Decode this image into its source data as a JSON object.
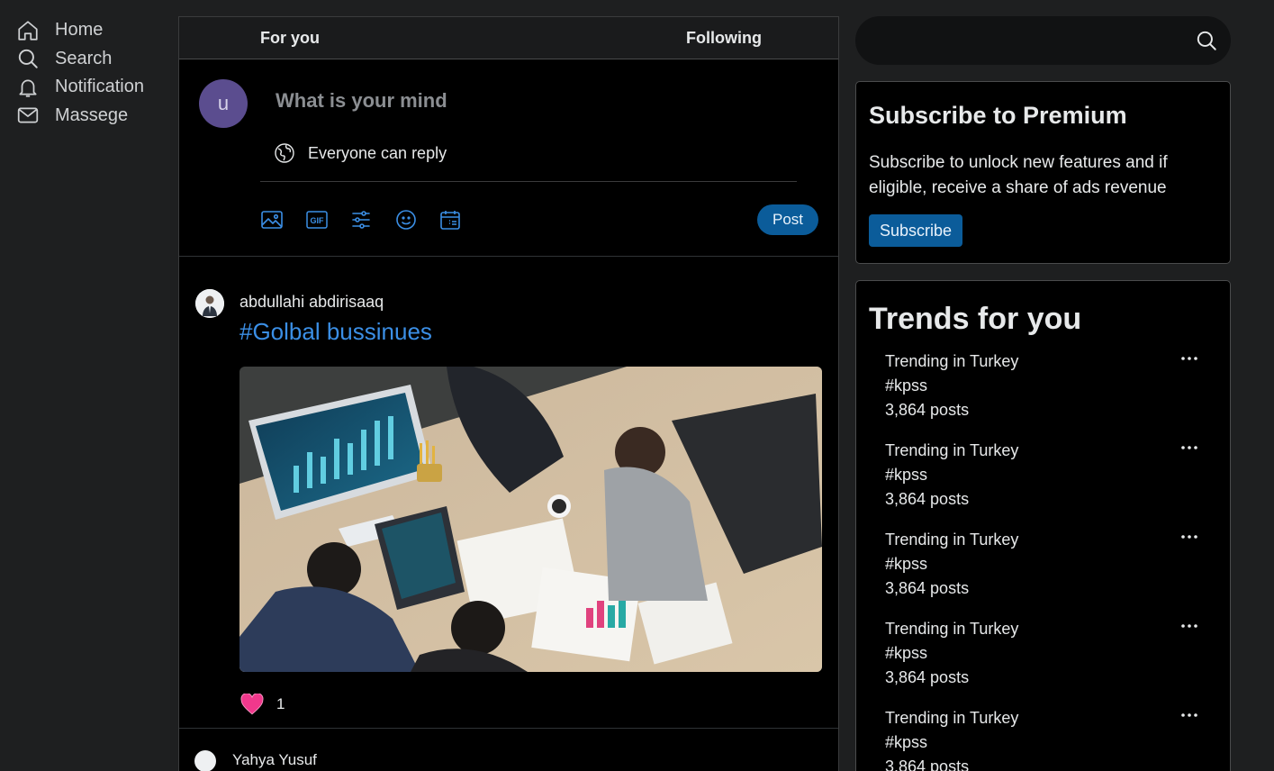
{
  "nav": {
    "items": [
      {
        "label": "Home",
        "icon": "home-icon"
      },
      {
        "label": "Search",
        "icon": "search-icon"
      },
      {
        "label": "Notification",
        "icon": "bell-icon"
      },
      {
        "label": "Massege",
        "icon": "mail-icon"
      }
    ]
  },
  "tabs": {
    "for_you": "For you",
    "following": "Following"
  },
  "composer": {
    "avatar_letter": "u",
    "placeholder": "What is your mind",
    "reply_scope": "Everyone can reply",
    "tools": [
      "image-icon",
      "gif-icon",
      "poll-icon",
      "emoji-icon",
      "schedule-icon"
    ],
    "post_label": "Post"
  },
  "posts": [
    {
      "author": "abdullahi abdirisaaq",
      "hashtag": "#Golbal bussinues",
      "likes": "1"
    },
    {
      "author": "Yahya Yusuf"
    }
  ],
  "sidebar": {
    "search_placeholder": "",
    "premium": {
      "title": "Subscribe to Premium",
      "text": "Subscribe to unlock new features and if eligible, receive a share of ads revenue",
      "button": "Subscribe"
    },
    "trends": {
      "title": "Trends for you",
      "items": [
        {
          "context": "Trending in Turkey",
          "tag": "#kpss",
          "posts": "3,864 posts"
        },
        {
          "context": "Trending in Turkey",
          "tag": "#kpss",
          "posts": "3,864 posts"
        },
        {
          "context": "Trending in Turkey",
          "tag": "#kpss",
          "posts": "3,864 posts"
        },
        {
          "context": "Trending in Turkey",
          "tag": "#kpss",
          "posts": "3,864 posts"
        },
        {
          "context": "Trending in Turkey",
          "tag": "#kpss",
          "posts": "3,864 posts"
        }
      ]
    }
  },
  "colors": {
    "accent": "#0b5c9a",
    "link": "#3b8fe6",
    "heart": "#f0388c"
  }
}
